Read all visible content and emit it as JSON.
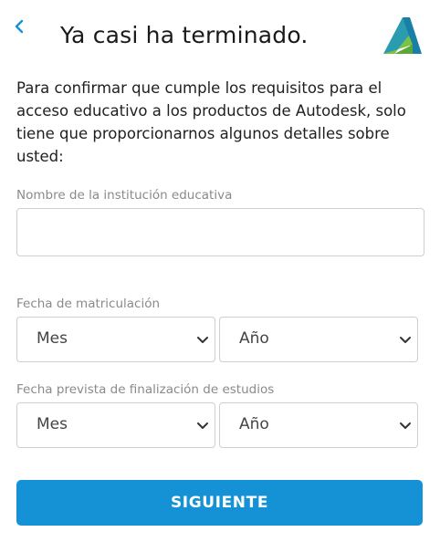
{
  "header": {
    "title": "Ya casi ha terminado.",
    "back_icon": "chevron-left-icon",
    "logo_icon": "autodesk-logo-icon"
  },
  "intro_text": "Para confirmar que cumple los requisitos para el acceso educativo a los productos de Autodesk, solo tiene que proporcionarnos algunos detalles sobre usted:",
  "institution": {
    "label": "Nombre de la institución educativa",
    "value": "",
    "placeholder": ""
  },
  "enrollment": {
    "label": "Fecha de matriculación",
    "month": "Mes",
    "year": "Año"
  },
  "graduation": {
    "label": "Fecha prevista de finalización de estudios",
    "month": "Mes",
    "year": "Año"
  },
  "next_button": "SIGUIENTE",
  "colors": {
    "accent": "#1592d6",
    "label_gray": "#8a8a8a",
    "border": "#cfcfcf"
  }
}
